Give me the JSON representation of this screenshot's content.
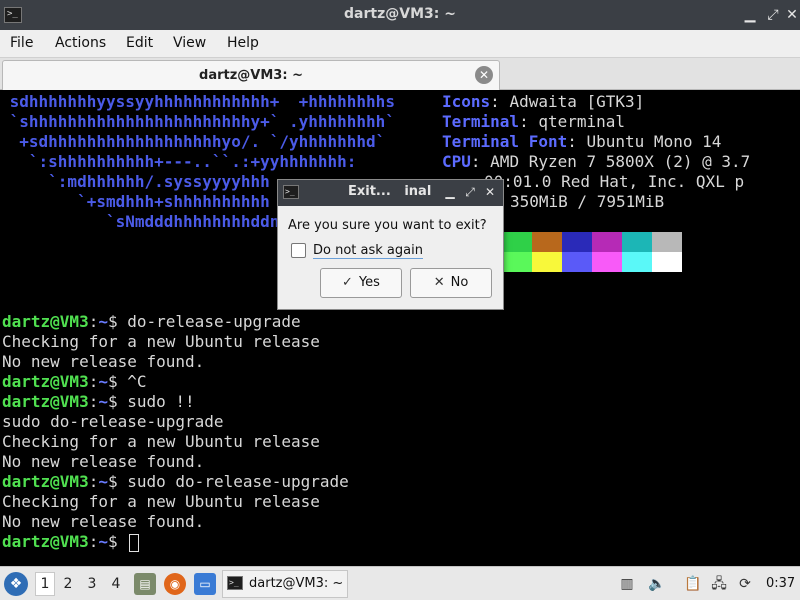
{
  "window": {
    "title": "dartz@VM3: ~",
    "icon": "terminal-icon",
    "controls": {
      "minimize": "▁",
      "maximize": "⤢",
      "close": "✕"
    }
  },
  "menubar": {
    "items": [
      "File",
      "Actions",
      "Edit",
      "View",
      "Help"
    ]
  },
  "tabs": [
    {
      "label": "dartz@VM3: ~",
      "close": "✕"
    }
  ],
  "terminal": {
    "colors": {
      "prompt_user": "#50e050",
      "prompt_path": "#6a7cff",
      "text": "#d8d8d8",
      "logo": "#4b5be8",
      "info_key": "#5c6bff"
    },
    "logo_lines": [
      " sdhhhhhhhyyssyyhhhhhhhhhhhh+  +hhhhhhhhs",
      " `shhhhhhhhhhhhhhhhhhhhhhhy+` .yhhhhhhhh`",
      "  +sdhhhhhhhhhhhhhhhhhhyo/. `/yhhhhhhhd`",
      "   `:shhhhhhhhhh+---..``.:+yyhhhhhhh:",
      "     `:mdhhhhhh/.syssyyyyhhh",
      "        `+smdhhh+shhhhhhhhhh",
      "           `sNmdddhhhhhhhhddn"
    ],
    "info": [
      {
        "key": "Icons",
        "value": "Adwaita [GTK3]"
      },
      {
        "key": "Terminal",
        "value": "qterminal"
      },
      {
        "key": "Terminal Font",
        "value": "Ubuntu Mono 14"
      },
      {
        "key": "CPU",
        "value": "AMD Ryzen 7 5800X (2) @ 3.7"
      },
      {
        "key": "",
        "value": "00:01.0 Red Hat, Inc. QXL p"
      },
      {
        "key": "",
        "value": "350MiB / 7951MiB"
      }
    ],
    "palette_top": [
      "#2fd048",
      "#b8681c",
      "#2a2ab8",
      "#b62ab6",
      "#1cb6b6",
      "#b8b8b8"
    ],
    "palette_bottom": [
      "#5af85a",
      "#f8f83a",
      "#5a5af8",
      "#f85af8",
      "#5af8f8",
      "#ffffff"
    ],
    "lines": [
      {
        "user": "dartz@VM3",
        "path": "~",
        "sym": "$ ",
        "text": "do-release-upgrade"
      },
      {
        "text": "Checking for a new Ubuntu release"
      },
      {
        "text": "No new release found."
      },
      {
        "user": "dartz@VM3",
        "path": "~",
        "sym": "$ ",
        "text": "^C"
      },
      {
        "user": "dartz@VM3",
        "path": "~",
        "sym": "$ ",
        "text": "sudo !!"
      },
      {
        "text": "sudo do-release-upgrade"
      },
      {
        "text": "Checking for a new Ubuntu release"
      },
      {
        "text": "No new release found."
      },
      {
        "user": "dartz@VM3",
        "path": "~",
        "sym": "$ ",
        "text": "sudo do-release-upgrade"
      },
      {
        "text": "Checking for a new Ubuntu release"
      },
      {
        "text": "No new release found."
      },
      {
        "user": "dartz@VM3",
        "path": "~",
        "sym": "$ ",
        "text": "",
        "cursor": true
      }
    ]
  },
  "dialog": {
    "title": "Exit...   inal",
    "icon": "terminal-icon",
    "controls": {
      "minimize": "▁",
      "maximize": "⤢",
      "close": "✕"
    },
    "question": "Are you sure you want to exit?",
    "checkbox_label": "Do not ask again",
    "checkbox_checked": false,
    "yes_label": "Yes",
    "yes_icon": "✓",
    "no_label": "No",
    "no_icon": "✕"
  },
  "taskbar": {
    "start_icon": "start-menu-icon",
    "workspaces": [
      "1",
      "2",
      "3",
      "4"
    ],
    "active_workspace": "1",
    "launchers": [
      "file-manager-icon",
      "firefox-icon",
      "desktop-icon"
    ],
    "task_label": "dartz@VM3: ~",
    "tray": [
      "trash-icon",
      "volume-icon",
      "clipboard-icon",
      "network-icon",
      "update-icon"
    ],
    "clock": "0:37"
  }
}
